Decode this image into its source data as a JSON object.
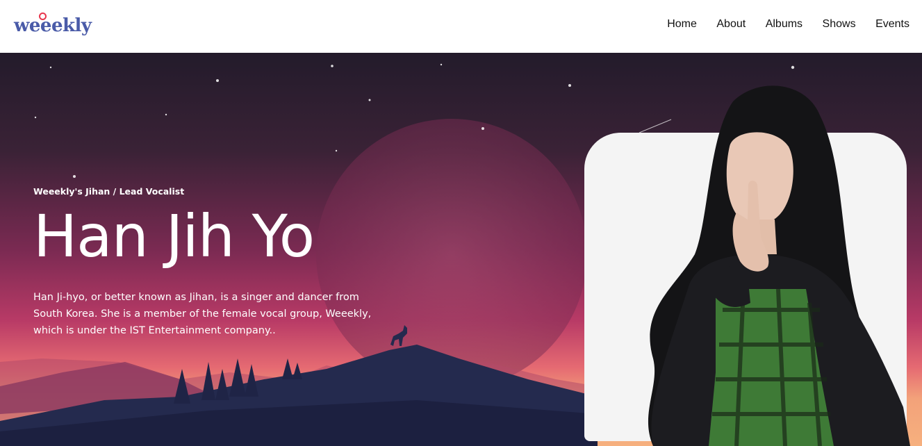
{
  "brand": {
    "logo_text": "weeekly",
    "logo_accent": "#e8364d",
    "logo_color": "#4a5ba8"
  },
  "nav": {
    "items": [
      {
        "label": "Home"
      },
      {
        "label": "About"
      },
      {
        "label": "Albums"
      },
      {
        "label": "Shows"
      },
      {
        "label": "Events"
      }
    ]
  },
  "hero": {
    "subtitle": "Weeekly's Jihan / Lead Vocalist",
    "title": "Han Jih Yo",
    "description": "Han Ji-hyo, or better known as Jihan, is a singer and dancer from South Korea. She is a member of the female vocal group, Weeekly, which is under the IST Entertainment company..",
    "colors": {
      "sky_top": "#241c2c",
      "sky_mid": "#8e2e5a",
      "horizon": "#e96a6a",
      "mountain": "#22264a"
    }
  }
}
